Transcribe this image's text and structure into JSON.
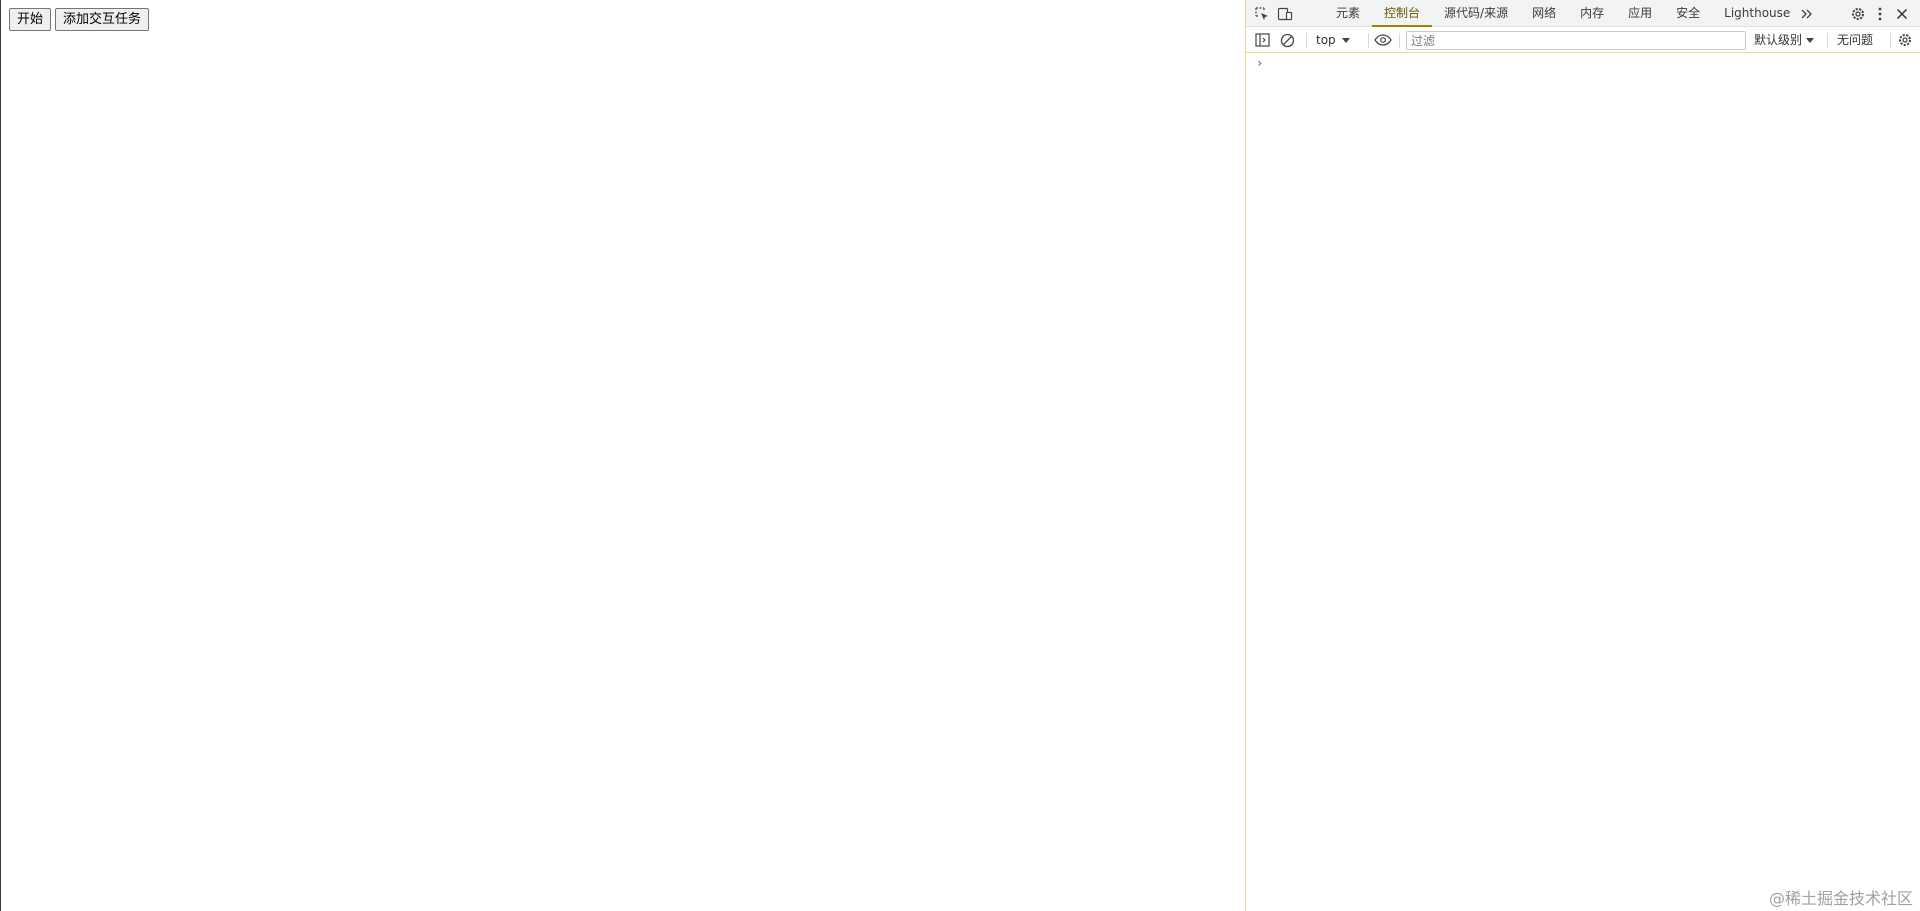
{
  "page": {
    "buttons": {
      "start_label": "开始",
      "add_task_label": "添加交互任务"
    }
  },
  "devtools": {
    "tabs": [
      {
        "label": "元素"
      },
      {
        "label": "控制台"
      },
      {
        "label": "源代码/来源"
      },
      {
        "label": "网络"
      },
      {
        "label": "内存"
      },
      {
        "label": "应用"
      },
      {
        "label": "安全"
      },
      {
        "label": "Lighthouse"
      }
    ],
    "active_tab": "控制台",
    "toolbar": {
      "context": "top",
      "filter_placeholder": "过滤",
      "level": "默认级别",
      "issues": "无问题"
    },
    "prompt_glyph": "›",
    "accent_color": "#9c8600"
  },
  "watermark": "@稀土掘金技术社区"
}
